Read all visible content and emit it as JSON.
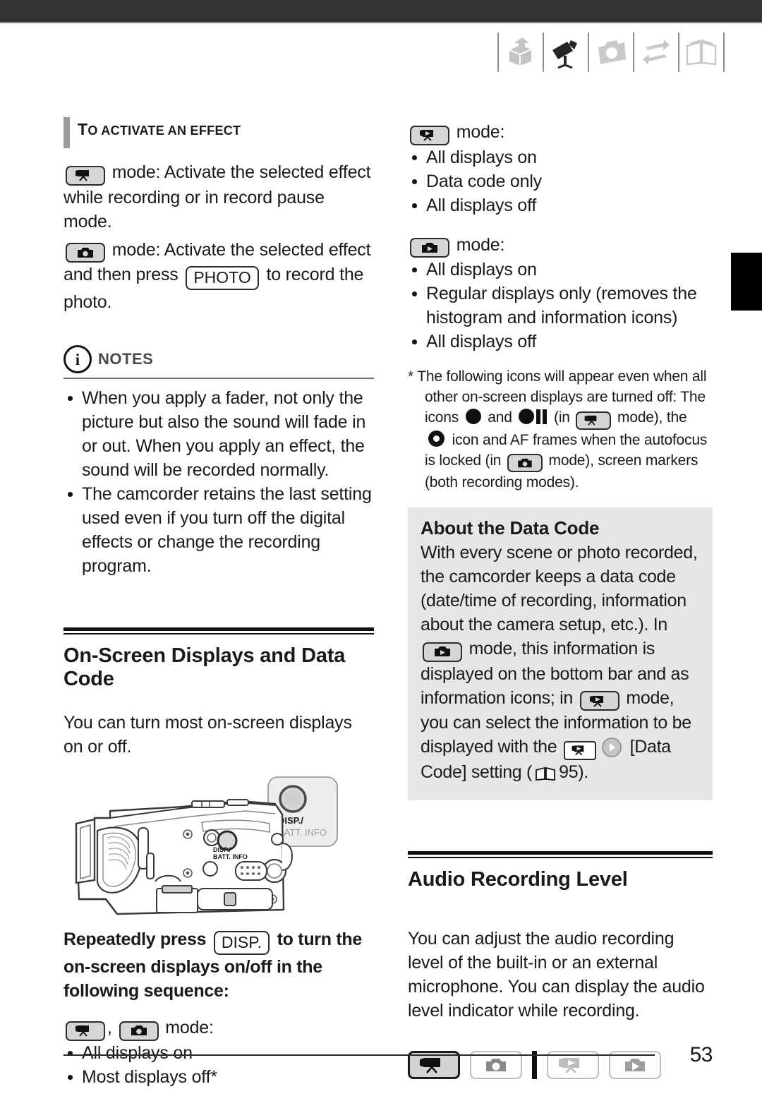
{
  "page": {
    "number": "53",
    "top_bar_color": "#333333",
    "callout_bg": "#e6e6e6",
    "badge_bg": "#d6d6d6"
  },
  "header": {
    "icons": [
      {
        "name": "introduction-box-icon",
        "state": "inactive"
      },
      {
        "name": "video-camera-icon",
        "state": "active"
      },
      {
        "name": "photo-camera-icon",
        "state": "inactive"
      },
      {
        "name": "transfer-arrows-icon",
        "state": "inactive"
      },
      {
        "name": "open-book-icon",
        "state": "inactive"
      }
    ]
  },
  "left_column": {
    "subheading": {
      "first_letter": "T",
      "rest": "O ACTIVATE AN EFFECT"
    },
    "activate_para_1": {
      "before": "",
      "after": " mode: Activate the selected effect while recording or in record pause mode."
    },
    "activate_para_2": {
      "seg1": " mode: Activate the selected effect and then press ",
      "key": "PHOTO",
      "seg2": " to record the photo."
    },
    "notes": {
      "label": "NOTES",
      "info_glyph": "i",
      "items": [
        "When you apply a fader, not only the picture but also the sound will fade in or out. When you apply an effect, the sound will be recorded normally.",
        "The camcorder retains the last setting used even if you turn off the digital effects or change the recording program."
      ]
    },
    "section": {
      "title": "On-Screen Displays and Data Code",
      "intro": "You can turn most on-screen displays on or off."
    },
    "figure": {
      "callout_line1": "DISP./",
      "callout_line2": "BATT. INFO",
      "body_label_line1": "DISP./",
      "body_label_line2": "BATT. INFO",
      "alt": "camcorder-side-view-illustration"
    },
    "instruction": {
      "seg1": "Repeatedly press ",
      "key": "DISP.",
      "seg2": " to turn the on-screen displays on/off in the following sequence:"
    },
    "record_modes": {
      "separator": ", ",
      "suffix": " mode:",
      "items": [
        "All displays on",
        "Most displays off*"
      ]
    }
  },
  "right_column": {
    "video_play_mode": {
      "suffix": " mode:",
      "items": [
        "All displays on",
        "Data code only",
        "All displays off"
      ]
    },
    "photo_play_mode": {
      "suffix": " mode:",
      "items": [
        "All displays on",
        "Regular displays only (removes the histogram and information icons)",
        "All displays off"
      ]
    },
    "footnote": {
      "marker": "*",
      "seg1": "The following icons will appear even when all other on-screen displays are turned off: The icons ",
      "seg2": " and ",
      "seg3": " (in ",
      "seg4": " mode), the ",
      "seg5": " icon and AF frames when the autofocus is locked (in ",
      "seg6": " mode), screen markers (both recording modes)."
    },
    "data_code_box": {
      "title": "About the Data Code",
      "seg1": "With every scene or photo recorded, the camcorder keeps a data code (date/time of recording, information about the camera setup, etc.). In ",
      "seg2": " mode, this information is displayed on the bottom bar and as information icons; in ",
      "seg3": " mode, you can select the information to be displayed with the ",
      "seg4": " [Data Code] setting (",
      "page_ref": "95",
      "seg5": ")."
    },
    "audio_section": {
      "title": "Audio Recording Level",
      "intro": "You can adjust the audio recording level of the built-in or an external microphone. You can display the audio level indicator while recording."
    },
    "mode_bar": [
      {
        "name": "mode-video-record",
        "state": "active"
      },
      {
        "name": "mode-photo-record",
        "state": "inactive"
      },
      {
        "name": "mode-video-play",
        "state": "inactive"
      },
      {
        "name": "mode-photo-play",
        "state": "inactive"
      }
    ]
  }
}
